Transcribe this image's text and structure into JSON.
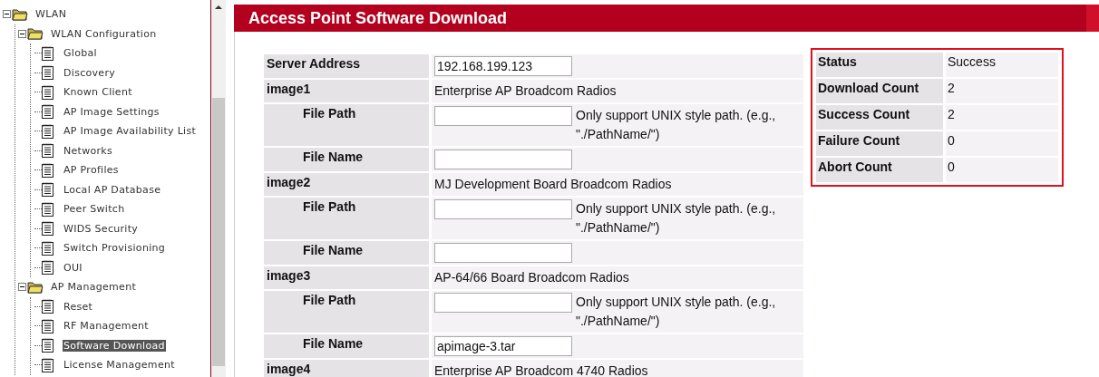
{
  "nav_tree": [
    {
      "label": "WLAN",
      "expanded": true,
      "children": [
        {
          "label": "WLAN Configuration",
          "expanded": true,
          "children": [
            {
              "label": "Global",
              "selected": false
            },
            {
              "label": "Discovery",
              "selected": false
            },
            {
              "label": "Known Client",
              "selected": false
            },
            {
              "label": "AP Image Settings",
              "selected": false
            },
            {
              "label": "AP Image Availability List",
              "selected": false
            },
            {
              "label": "Networks",
              "selected": false
            },
            {
              "label": "AP Profiles",
              "selected": false
            },
            {
              "label": "Local AP Database",
              "selected": false
            },
            {
              "label": "Peer Switch",
              "selected": false
            },
            {
              "label": "WIDS Security",
              "selected": false
            },
            {
              "label": "Switch Provisioning",
              "selected": false
            },
            {
              "label": "OUI",
              "selected": false
            }
          ]
        },
        {
          "label": "AP Management",
          "expanded": true,
          "children": [
            {
              "label": "Reset",
              "selected": false
            },
            {
              "label": "RF Management",
              "selected": false
            },
            {
              "label": "Software Download",
              "selected": true
            },
            {
              "label": "License Management",
              "selected": false
            }
          ]
        }
      ]
    }
  ],
  "page_title": "Access Point Software Download",
  "form": {
    "rows": [
      {
        "kind": "field",
        "label": "Server Address",
        "value": "192.168.199.123"
      },
      {
        "kind": "image",
        "label": "image1",
        "description": "Enterprise AP Broadcom Radios"
      },
      {
        "kind": "sub",
        "label": "File Path",
        "value": "",
        "note": "Only support UNIX style path. (e.g., \"./PathName/\")"
      },
      {
        "kind": "sub",
        "label": "File Name",
        "value": ""
      },
      {
        "kind": "image",
        "label": "image2",
        "description": "MJ Development Board Broadcom Radios"
      },
      {
        "kind": "sub",
        "label": "File Path",
        "value": "",
        "note": "Only support UNIX style path. (e.g., \"./PathName/\")"
      },
      {
        "kind": "sub",
        "label": "File Name",
        "value": ""
      },
      {
        "kind": "image",
        "label": "image3",
        "description": "AP-64/66 Board Broadcom Radios"
      },
      {
        "kind": "sub",
        "label": "File Path",
        "value": "",
        "note": "Only support UNIX style path. (e.g., \"./PathName/\")"
      },
      {
        "kind": "sub",
        "label": "File Name",
        "value": "apimage-3.tar"
      },
      {
        "kind": "image",
        "label": "image4",
        "description": "Enterprise AP Broadcom 4740 Radios"
      }
    ]
  },
  "status": [
    {
      "label": "Status",
      "value": "Success"
    },
    {
      "label": "Download Count",
      "value": "2"
    },
    {
      "label": "Success Count",
      "value": "2"
    },
    {
      "label": "Failure Count",
      "value": "0"
    },
    {
      "label": "Abort Count",
      "value": "0"
    }
  ]
}
